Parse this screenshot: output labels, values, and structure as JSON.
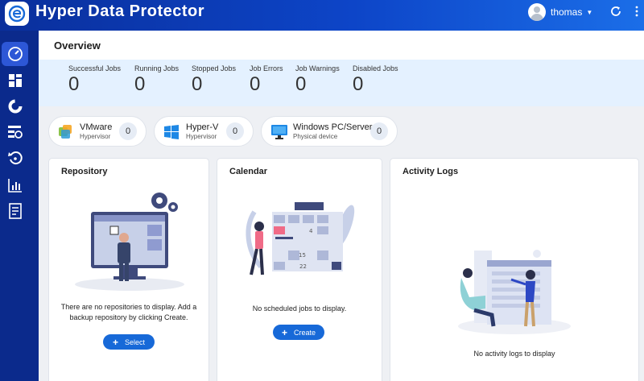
{
  "app": {
    "title": "Hyper Data Protector"
  },
  "user": {
    "name": "thomas"
  },
  "overview": {
    "title": "Overview",
    "stats": [
      {
        "label": "Successful Jobs",
        "value": "0"
      },
      {
        "label": "Running Jobs",
        "value": "0"
      },
      {
        "label": "Stopped Jobs",
        "value": "0"
      },
      {
        "label": "Job Errors",
        "value": "0"
      },
      {
        "label": "Job Warnings",
        "value": "0"
      },
      {
        "label": "Disabled Jobs",
        "value": "0"
      }
    ]
  },
  "sources": [
    {
      "name": "VMware",
      "type": "Hypervisor",
      "count": "0"
    },
    {
      "name": "Hyper-V",
      "type": "Hypervisor",
      "count": "0"
    },
    {
      "name": "Windows PC/Server",
      "type": "Physical device",
      "count": "0"
    }
  ],
  "repository": {
    "title": "Repository",
    "message": "There are no repositories to display. Add a backup repository by clicking Create.",
    "button": "Select"
  },
  "calendar": {
    "title": "Calendar",
    "message": "No scheduled jobs to display.",
    "button": "Create",
    "illus_dates": [
      "4",
      "15",
      "22"
    ]
  },
  "activity": {
    "title": "Activity Logs",
    "message": "No activity logs to display"
  },
  "colors": {
    "accent": "#1769d8",
    "topbar": "#0d45c8",
    "sidebar": "#0b2a8c",
    "stats_bg": "#e4f1ff"
  }
}
